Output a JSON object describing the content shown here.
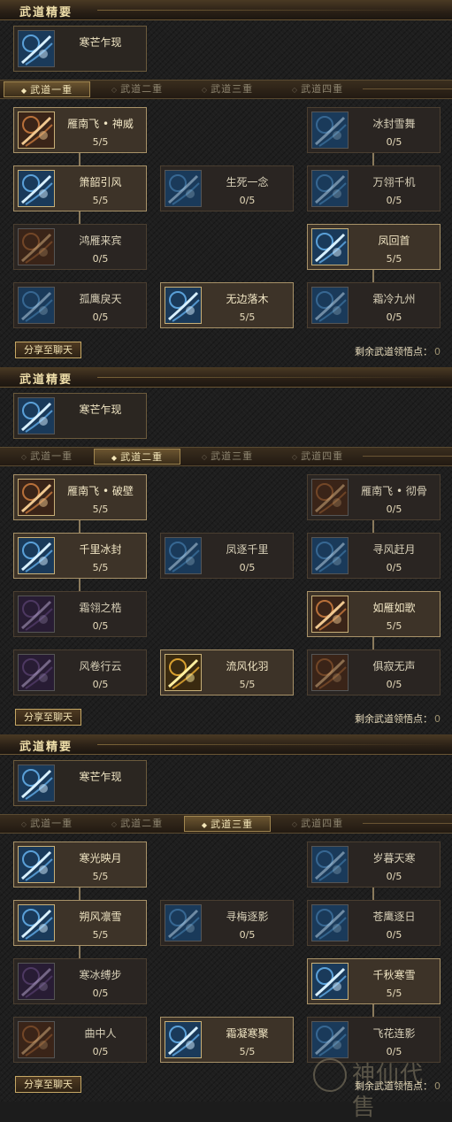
{
  "section_title": "武道精要",
  "tab_labels": [
    "武道一重",
    "武道二重",
    "武道三重",
    "武道四重"
  ],
  "share_label": "分享至聊天",
  "remain_label": "剩余武道领悟点：",
  "remain_value": "0",
  "watermark": "神仙代售",
  "panels": [
    {
      "essence": {
        "name": "寒芒乍现",
        "icon": "blade-strike-icon",
        "learned": false
      },
      "active_tab": 0,
      "nodes": [
        {
          "name": "雁南飞 • 神威",
          "points": "5/5",
          "learned": true,
          "icon": "swift-strike-icon",
          "tone": "warm"
        },
        {
          "name": "冰封雪舞",
          "points": "0/5",
          "learned": false,
          "icon": "ice-dance-icon",
          "tone": "ice"
        },
        {
          "name": "箫韶引风",
          "points": "5/5",
          "learned": true,
          "icon": "wind-flute-icon",
          "tone": "ice"
        },
        {
          "name": "生死一念",
          "points": "0/5",
          "learned": false,
          "icon": "life-death-icon",
          "tone": "ice"
        },
        {
          "name": "万翎千机",
          "points": "0/5",
          "learned": false,
          "icon": "feather-blades-icon",
          "tone": "ice"
        },
        {
          "name": "鸿雁来宾",
          "points": "0/5",
          "learned": false,
          "icon": "goose-icon",
          "tone": "warm"
        },
        {
          "name": "凤回首",
          "points": "5/5",
          "learned": true,
          "icon": "phoenix-icon",
          "tone": "ice"
        },
        {
          "name": "孤鹰戾天",
          "points": "0/5",
          "learned": false,
          "icon": "eagle-icon",
          "tone": "ice"
        },
        {
          "name": "无边落木",
          "points": "5/5",
          "learned": true,
          "icon": "falling-leaves-icon",
          "tone": "ice"
        },
        {
          "name": "霜冷九州",
          "points": "0/5",
          "learned": false,
          "icon": "frost-icon",
          "tone": "ice"
        }
      ]
    },
    {
      "essence": {
        "name": "寒芒乍现",
        "icon": "blade-strike-icon",
        "learned": false
      },
      "active_tab": 1,
      "nodes": [
        {
          "name": "雁南飞 • 破壁",
          "points": "5/5",
          "learned": true,
          "icon": "swift-strike-icon",
          "tone": "warm"
        },
        {
          "name": "雁南飞 • 彻骨",
          "points": "0/5",
          "learned": false,
          "icon": "swift-strike-icon",
          "tone": "warm"
        },
        {
          "name": "千里冰封",
          "points": "5/5",
          "learned": true,
          "icon": "frozen-icon",
          "tone": "ice"
        },
        {
          "name": "凤逐千里",
          "points": "0/5",
          "learned": false,
          "icon": "phoenix-chase-icon",
          "tone": "ice"
        },
        {
          "name": "寻风赶月",
          "points": "0/5",
          "learned": false,
          "icon": "wind-moon-icon",
          "tone": "ice"
        },
        {
          "name": "霜翎之梏",
          "points": "0/5",
          "learned": false,
          "icon": "frost-feather-icon",
          "tone": "violet"
        },
        {
          "name": "如雁如歌",
          "points": "5/5",
          "learned": true,
          "icon": "goose-song-icon",
          "tone": "warm"
        },
        {
          "name": "风卷行云",
          "points": "0/5",
          "learned": false,
          "icon": "whirlwind-icon",
          "tone": "violet"
        },
        {
          "name": "流风化羽",
          "points": "5/5",
          "learned": true,
          "icon": "wind-feather-icon",
          "tone": "gold"
        },
        {
          "name": "俱寂无声",
          "points": "0/5",
          "learned": false,
          "icon": "silence-icon",
          "tone": "warm"
        }
      ]
    },
    {
      "essence": {
        "name": "寒芒乍现",
        "icon": "blade-strike-icon",
        "learned": false
      },
      "active_tab": 2,
      "nodes": [
        {
          "name": "寒光映月",
          "points": "5/5",
          "learned": true,
          "icon": "cold-moon-icon",
          "tone": "ice"
        },
        {
          "name": "岁暮天寒",
          "points": "0/5",
          "learned": false,
          "icon": "winter-icon",
          "tone": "ice"
        },
        {
          "name": "朔风凛雪",
          "points": "5/5",
          "learned": true,
          "icon": "north-wind-icon",
          "tone": "ice"
        },
        {
          "name": "寻梅逐影",
          "points": "0/5",
          "learned": false,
          "icon": "plum-shadow-icon",
          "tone": "ice"
        },
        {
          "name": "苍鹰逐日",
          "points": "0/5",
          "learned": false,
          "icon": "hawk-sun-icon",
          "tone": "ice"
        },
        {
          "name": "寒冰缚步",
          "points": "0/5",
          "learned": false,
          "icon": "ice-bind-icon",
          "tone": "violet"
        },
        {
          "name": "千秋寒雪",
          "points": "5/5",
          "learned": true,
          "icon": "snowflake-icon",
          "tone": "ice"
        },
        {
          "name": "曲中人",
          "points": "0/5",
          "learned": false,
          "icon": "musician-icon",
          "tone": "warm"
        },
        {
          "name": "霜凝寒聚",
          "points": "5/5",
          "learned": true,
          "icon": "frost-gather-icon",
          "tone": "ice"
        },
        {
          "name": "飞花连影",
          "points": "0/5",
          "learned": false,
          "icon": "flying-flowers-icon",
          "tone": "ice"
        }
      ]
    }
  ]
}
